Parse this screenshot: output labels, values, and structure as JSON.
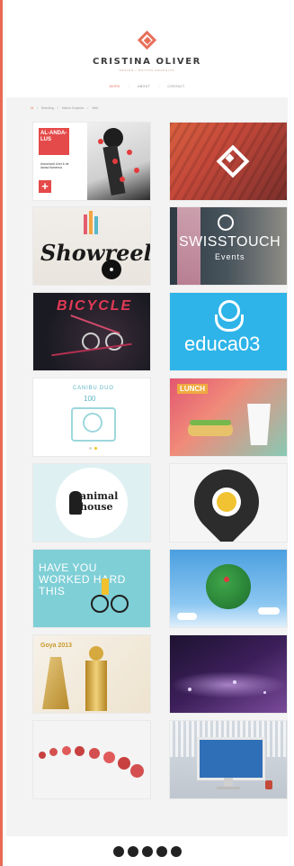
{
  "brand": {
    "name": "CRISTINA OLIVER",
    "tagline": "DESIGN / MOTION GRAPHICS",
    "accent_color": "#ea6a55"
  },
  "nav": {
    "items": [
      {
        "label": "WORK",
        "active": true
      },
      {
        "label": "ABOUT",
        "active": false
      },
      {
        "label": "CONTACT",
        "active": false
      }
    ],
    "separator": "/"
  },
  "breadcrumb": {
    "items": [
      "Hi",
      "Branding",
      "Motion Graphics",
      "Web"
    ],
    "separator": "/"
  },
  "portfolio": {
    "tiles": [
      {
        "id": "alandalus",
        "title": "AL-ANDA-LUS",
        "subtitle": "Associació d'art & de dansa flamenca",
        "plus": "+"
      },
      {
        "id": "diamond-logo",
        "title": ""
      },
      {
        "id": "showreel",
        "title": "Showreel"
      },
      {
        "id": "swisstouch",
        "title": "SWISSTOUCH",
        "subtitle": "Events"
      },
      {
        "id": "bicycle",
        "title": "BICYCLE"
      },
      {
        "id": "educa03",
        "title": "educa03"
      },
      {
        "id": "canibu",
        "title": "CANIBU DUO",
        "subtitle": "100"
      },
      {
        "id": "lunch",
        "title": "LUNCH"
      },
      {
        "id": "animalhouse",
        "title": "animal house"
      },
      {
        "id": "food-pin",
        "title": ""
      },
      {
        "id": "worked-hard",
        "title": "HAVE YOU WORKED HARD THIS"
      },
      {
        "id": "earth",
        "title": ""
      },
      {
        "id": "award",
        "title": "Goya 2013"
      },
      {
        "id": "purple-motion",
        "title": ""
      },
      {
        "id": "football",
        "title": ""
      },
      {
        "id": "imac-web",
        "title": ""
      }
    ]
  },
  "pagination": {
    "dots": 5
  }
}
